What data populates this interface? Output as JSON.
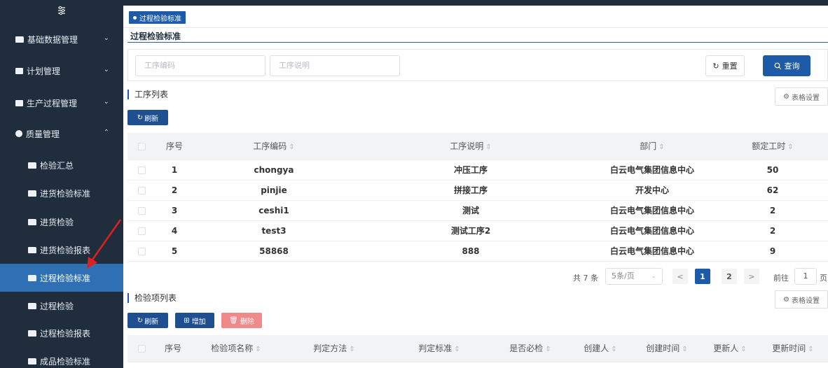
{
  "sidebar": {
    "toggle_icon": "sliders-icon",
    "groups": [
      {
        "label": "基础数据管理",
        "chevron": "⌄"
      },
      {
        "label": "计划管理",
        "chevron": "⌄"
      },
      {
        "label": "生产过程管理",
        "chevron": "⌄"
      },
      {
        "label": "质量管理",
        "chevron": "⌃"
      }
    ],
    "items": [
      {
        "label": "检验汇总"
      },
      {
        "label": "进货检验标准"
      },
      {
        "label": "进货检验"
      },
      {
        "label": "进货检验报表"
      },
      {
        "label": "过程检验标准"
      },
      {
        "label": "过程检验"
      },
      {
        "label": "过程检验报表"
      },
      {
        "label": "成品检验标准"
      }
    ],
    "active_item": "过程检验标准"
  },
  "tabs": {
    "active": "过程检验标准"
  },
  "page": {
    "title": "过程检验标准"
  },
  "search": {
    "code_placeholder": "工序编码",
    "desc_placeholder": "工序说明",
    "reset_label": "重置",
    "query_label": "查询"
  },
  "process_list": {
    "title": "工序列表",
    "settings_label": "表格设置",
    "refresh_label": "刷新",
    "columns": [
      "序号",
      "工序编码",
      "工序说明",
      "部门",
      "额定工时"
    ],
    "rows": [
      {
        "no": "1",
        "code": "chongya",
        "desc": "冲压工序",
        "dept": "白云电气集团信息中心",
        "hours": "50"
      },
      {
        "no": "2",
        "code": "pinjie",
        "desc": "拼接工序",
        "dept": "开发中心",
        "hours": "62"
      },
      {
        "no": "3",
        "code": "ceshi1",
        "desc": "测试",
        "dept": "白云电气集团信息中心",
        "hours": "2"
      },
      {
        "no": "4",
        "code": "test3",
        "desc": "测试工序2",
        "dept": "白云电气集团信息中心",
        "hours": "2"
      },
      {
        "no": "5",
        "code": "58868",
        "desc": "888",
        "dept": "白云电气集团信息中心",
        "hours": "9"
      }
    ]
  },
  "pagination": {
    "total": "共 7 条",
    "page_size": "5条/页",
    "prev": "<",
    "pages": [
      "1",
      "2"
    ],
    "current_page": "1",
    "next": ">",
    "goto_label": "前往",
    "goto_value": "1",
    "page_suffix": "页"
  },
  "inspection_list": {
    "title": "检验项列表",
    "settings_label": "表格设置",
    "refresh_label": "刷新",
    "add_label": "增加",
    "delete_label": "删除",
    "columns": [
      "序号",
      "检验项名称",
      "判定方法",
      "判定标准",
      "是否必检",
      "创建人",
      "创建时间",
      "更新人",
      "更新时间"
    ]
  },
  "colors": {
    "sidebar_bg": "#1f2d3d",
    "active_item": "#2f6fb4",
    "primary": "#1d5aa8",
    "danger_light": "#f08a8a",
    "annotation_arrow": "#e02020"
  }
}
